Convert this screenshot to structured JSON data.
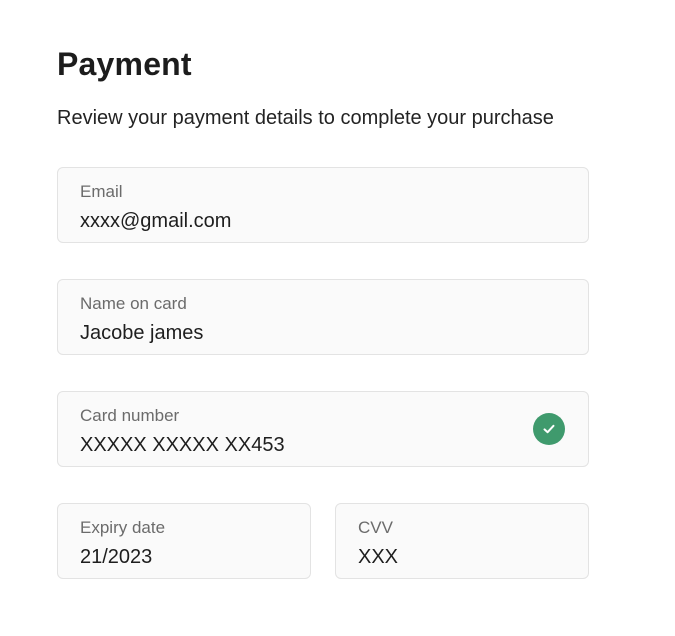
{
  "header": {
    "title": "Payment",
    "subtitle": "Review your payment details to complete your purchase"
  },
  "form": {
    "email": {
      "label": "Email",
      "value": "xxxx@gmail.com"
    },
    "name_on_card": {
      "label": "Name on card",
      "value": "Jacobe james"
    },
    "card_number": {
      "label": "Card number",
      "value": "XXXXX XXXXX XX453",
      "status_icon": "check-circle-icon",
      "status_color": "#3f9a6d"
    },
    "expiry_date": {
      "label": "Expiry date",
      "value": "21/2023"
    },
    "cvv": {
      "label": "CVV",
      "value": "XXX"
    }
  }
}
